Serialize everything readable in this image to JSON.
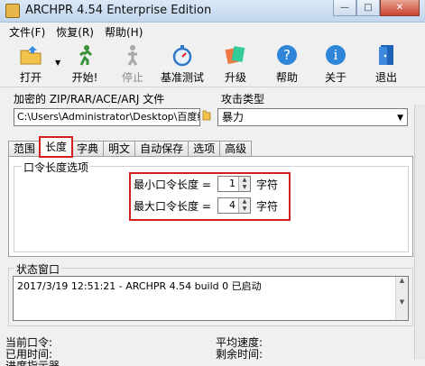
{
  "window": {
    "title": "ARCHPR 4.54 Enterprise Edition",
    "min": "—",
    "max": "□",
    "close": "✕"
  },
  "menu": [
    "文件(F)",
    "恢复(R)",
    "帮助(H)"
  ],
  "toolbar": {
    "open": "打开",
    "start": "开始!",
    "stop": "停止",
    "benchmark": "基准测试",
    "upgrade": "升级",
    "help": "帮助",
    "about": "关于",
    "exit": "退出"
  },
  "file_section": {
    "label": "加密的 ZIP/RAR/ACE/ARJ 文件",
    "path": "C:\\Users\\Administrator\\Desktop\\百度经验"
  },
  "attack": {
    "label": "攻击类型",
    "selected": "暴力"
  },
  "tabs": [
    "范围",
    "长度",
    "字典",
    "明文",
    "自动保存",
    "选项",
    "高级"
  ],
  "length_tab": {
    "group_title": "口令长度选项",
    "min_label": "最小口令长度 =",
    "min_value": "1",
    "max_label": "最大口令长度 =",
    "max_value": "4",
    "unit": "字符"
  },
  "status": {
    "title": "状态窗口",
    "log": [
      "2017/3/19 12:51:21 - ARCHPR 4.54 build 0 已启动"
    ]
  },
  "footer": {
    "current_password": "当前口令:",
    "avg_speed": "平均速度:",
    "elapsed": "已用时间:",
    "remaining": "剩余时间:",
    "progress": "进度指示器"
  },
  "colors": {
    "highlight": "#d21f1f",
    "chrome": "#f0f0f0",
    "titlebar": "#c9d9ec"
  }
}
